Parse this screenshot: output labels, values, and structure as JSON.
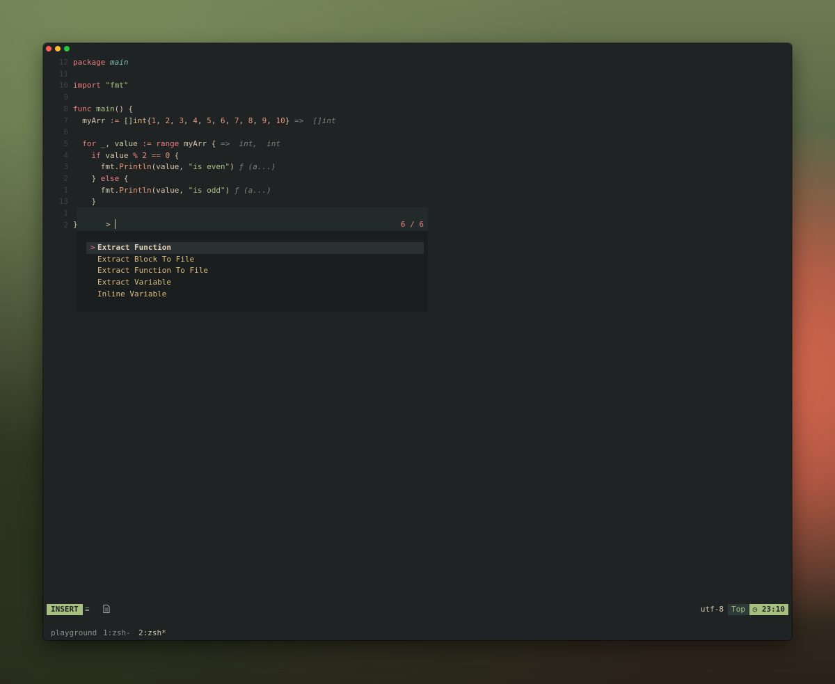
{
  "window": {
    "controls": [
      "close",
      "minimize",
      "zoom"
    ]
  },
  "editor": {
    "lines": [
      {
        "num": "12",
        "segments": [
          [
            "kw",
            "package "
          ],
          [
            "pkg",
            "main"
          ]
        ]
      },
      {
        "num": "11",
        "segments": []
      },
      {
        "num": "10",
        "segments": [
          [
            "kw",
            "import "
          ],
          [
            "str",
            "\"fmt\""
          ]
        ]
      },
      {
        "num": "9",
        "segments": []
      },
      {
        "num": "8",
        "segments": [
          [
            "kw",
            "func "
          ],
          [
            "fn",
            "main"
          ],
          [
            "var",
            "() {"
          ]
        ]
      },
      {
        "num": "7",
        "segments": [
          [
            "var",
            "  myArr "
          ],
          [
            "op",
            ":="
          ],
          [
            "var",
            " []"
          ],
          [
            "ty",
            "int"
          ],
          [
            "var",
            "{"
          ],
          [
            "num",
            "1"
          ],
          [
            "var",
            ", "
          ],
          [
            "num",
            "2"
          ],
          [
            "var",
            ", "
          ],
          [
            "num",
            "3"
          ],
          [
            "var",
            ", "
          ],
          [
            "num",
            "4"
          ],
          [
            "var",
            ", "
          ],
          [
            "num",
            "5"
          ],
          [
            "var",
            ", "
          ],
          [
            "num",
            "6"
          ],
          [
            "var",
            ", "
          ],
          [
            "num",
            "7"
          ],
          [
            "var",
            ", "
          ],
          [
            "num",
            "8"
          ],
          [
            "var",
            ", "
          ],
          [
            "num",
            "9"
          ],
          [
            "var",
            ", "
          ],
          [
            "num",
            "10"
          ],
          [
            "var",
            "} "
          ],
          [
            "hint",
            "=>  []int"
          ]
        ]
      },
      {
        "num": "6",
        "segments": []
      },
      {
        "num": "5",
        "segments": [
          [
            "kw",
            "  for "
          ],
          [
            "var",
            "_, value "
          ],
          [
            "op",
            ":="
          ],
          [
            "kw",
            " range "
          ],
          [
            "var",
            "myArr { "
          ],
          [
            "hint",
            "=>  int,  int"
          ]
        ]
      },
      {
        "num": "4",
        "segments": [
          [
            "kw",
            "    if "
          ],
          [
            "var",
            "value "
          ],
          [
            "op",
            "%"
          ],
          [
            "var",
            " "
          ],
          [
            "num",
            "2"
          ],
          [
            "var",
            " "
          ],
          [
            "op",
            "=="
          ],
          [
            "var",
            " "
          ],
          [
            "num",
            "0"
          ],
          [
            "var",
            " {"
          ]
        ]
      },
      {
        "num": "3",
        "segments": [
          [
            "var",
            "      fmt."
          ],
          [
            "meth",
            "Println"
          ],
          [
            "var",
            "(value, "
          ],
          [
            "str",
            "\"is even\""
          ],
          [
            "var",
            ") "
          ],
          [
            "hint",
            "ƒ (a...)"
          ]
        ]
      },
      {
        "num": "2",
        "segments": [
          [
            "var",
            "    } "
          ],
          [
            "kw",
            "else"
          ],
          [
            "var",
            " {"
          ]
        ]
      },
      {
        "num": "1",
        "segments": [
          [
            "var",
            "      fmt."
          ],
          [
            "meth",
            "Println"
          ],
          [
            "var",
            "(value, "
          ],
          [
            "str",
            "\"is odd\""
          ],
          [
            "var",
            ") "
          ],
          [
            "hint",
            "ƒ (a...)"
          ]
        ]
      },
      {
        "num": "13",
        "segments": [
          [
            "var",
            "    }"
          ]
        ]
      },
      {
        "num": "1",
        "segments": []
      },
      {
        "num": "2",
        "segments": [
          [
            "var",
            "}"
          ]
        ]
      }
    ]
  },
  "picker": {
    "prompt": ">",
    "count": "6 / 6",
    "selected_marker": ">",
    "items": [
      "Extract Function",
      "Extract Block To File",
      "Extract Function To File",
      "Extract Variable",
      "Inline Variable"
    ]
  },
  "statusbar": {
    "mode": "INSERT",
    "encoding": "utf-8",
    "position": "Top",
    "time": "23:10"
  },
  "tmux": {
    "session": "playground",
    "windows": [
      "1:zsh-",
      "2:zsh*"
    ]
  },
  "colors": {
    "accent": "#a7c080",
    "keyword": "#e67e80",
    "number": "#e69875",
    "type": "#dbbc7f",
    "background": "#1f2324"
  }
}
